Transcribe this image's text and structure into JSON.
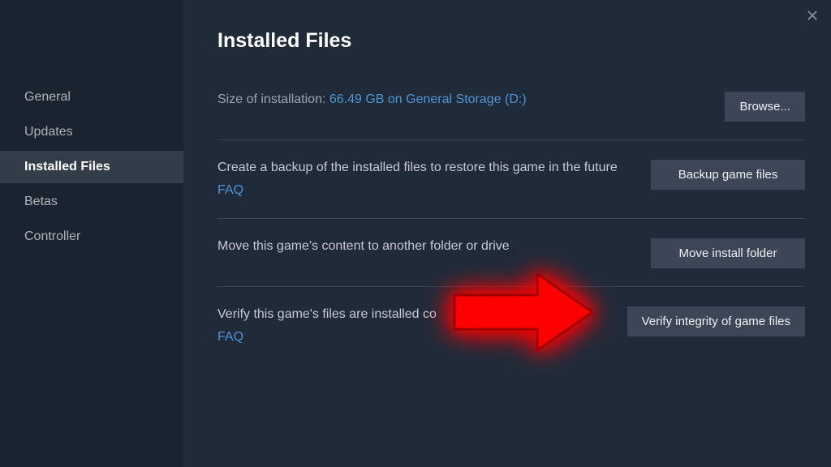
{
  "sidebar": {
    "items": [
      {
        "label": "General",
        "active": false
      },
      {
        "label": "Updates",
        "active": false
      },
      {
        "label": "Installed Files",
        "active": true
      },
      {
        "label": "Betas",
        "active": false
      },
      {
        "label": "Controller",
        "active": false
      }
    ]
  },
  "page": {
    "title": "Installed Files"
  },
  "sections": {
    "size": {
      "label": "Size of installation: ",
      "value": "66.49 GB on General Storage (D:)",
      "button": "Browse..."
    },
    "backup": {
      "description": "Create a backup of the installed files to restore this game in the future",
      "faq": "FAQ",
      "button": "Backup game files"
    },
    "move": {
      "description": "Move this game's content to another folder or drive",
      "button": "Move install folder"
    },
    "verify": {
      "description": "Verify this game's files are installed co",
      "faq": "FAQ",
      "button": "Verify integrity of game files"
    }
  }
}
